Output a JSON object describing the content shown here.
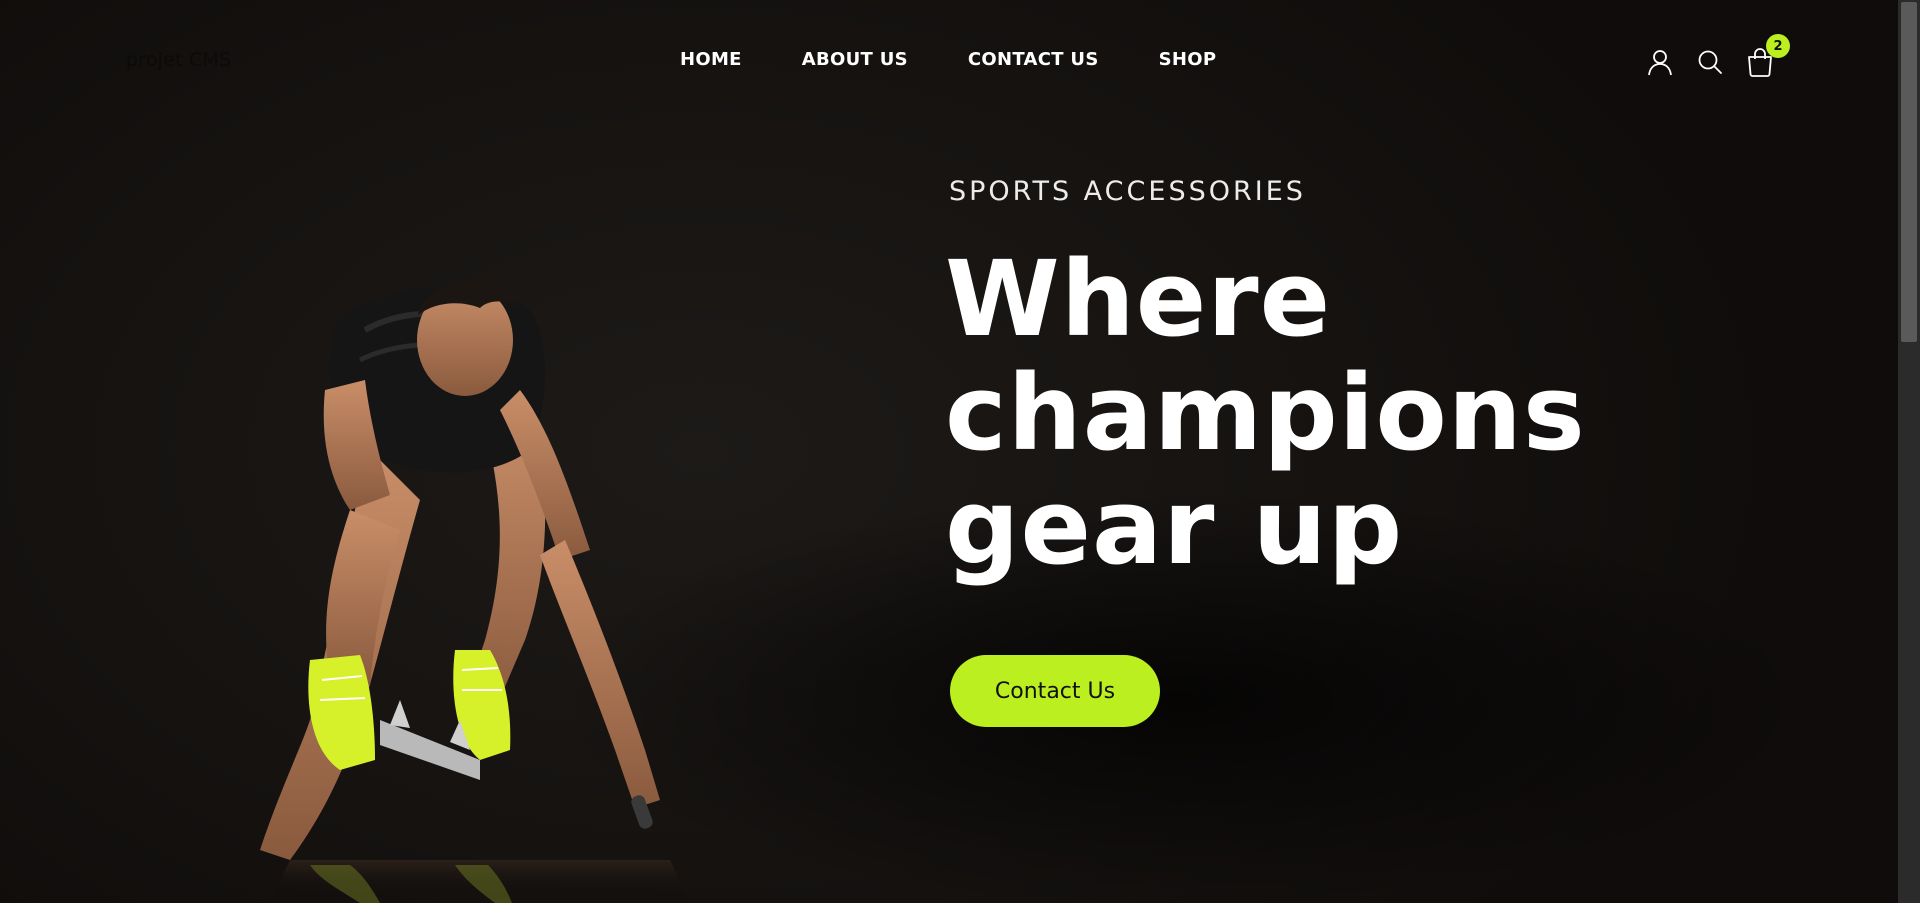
{
  "brand": {
    "name": "projet CMS"
  },
  "nav": {
    "items": [
      {
        "label": "HOME"
      },
      {
        "label": "ABOUT US"
      },
      {
        "label": "CONTACT US"
      },
      {
        "label": "SHOP"
      }
    ]
  },
  "header_icons": {
    "account": "user-icon",
    "search": "search-icon",
    "cart": "shopping-bag-icon",
    "cart_count": "2"
  },
  "hero": {
    "eyebrow": "SPORTS ACCESSORIES",
    "headline_lines": [
      "Where",
      "champions",
      "gear up"
    ],
    "cta_label": "Contact Us",
    "image": "sprinter-in-starting-blocks-photo"
  },
  "colors": {
    "accent": "#bbef1f",
    "background": "#141110",
    "text": "#ffffff"
  }
}
